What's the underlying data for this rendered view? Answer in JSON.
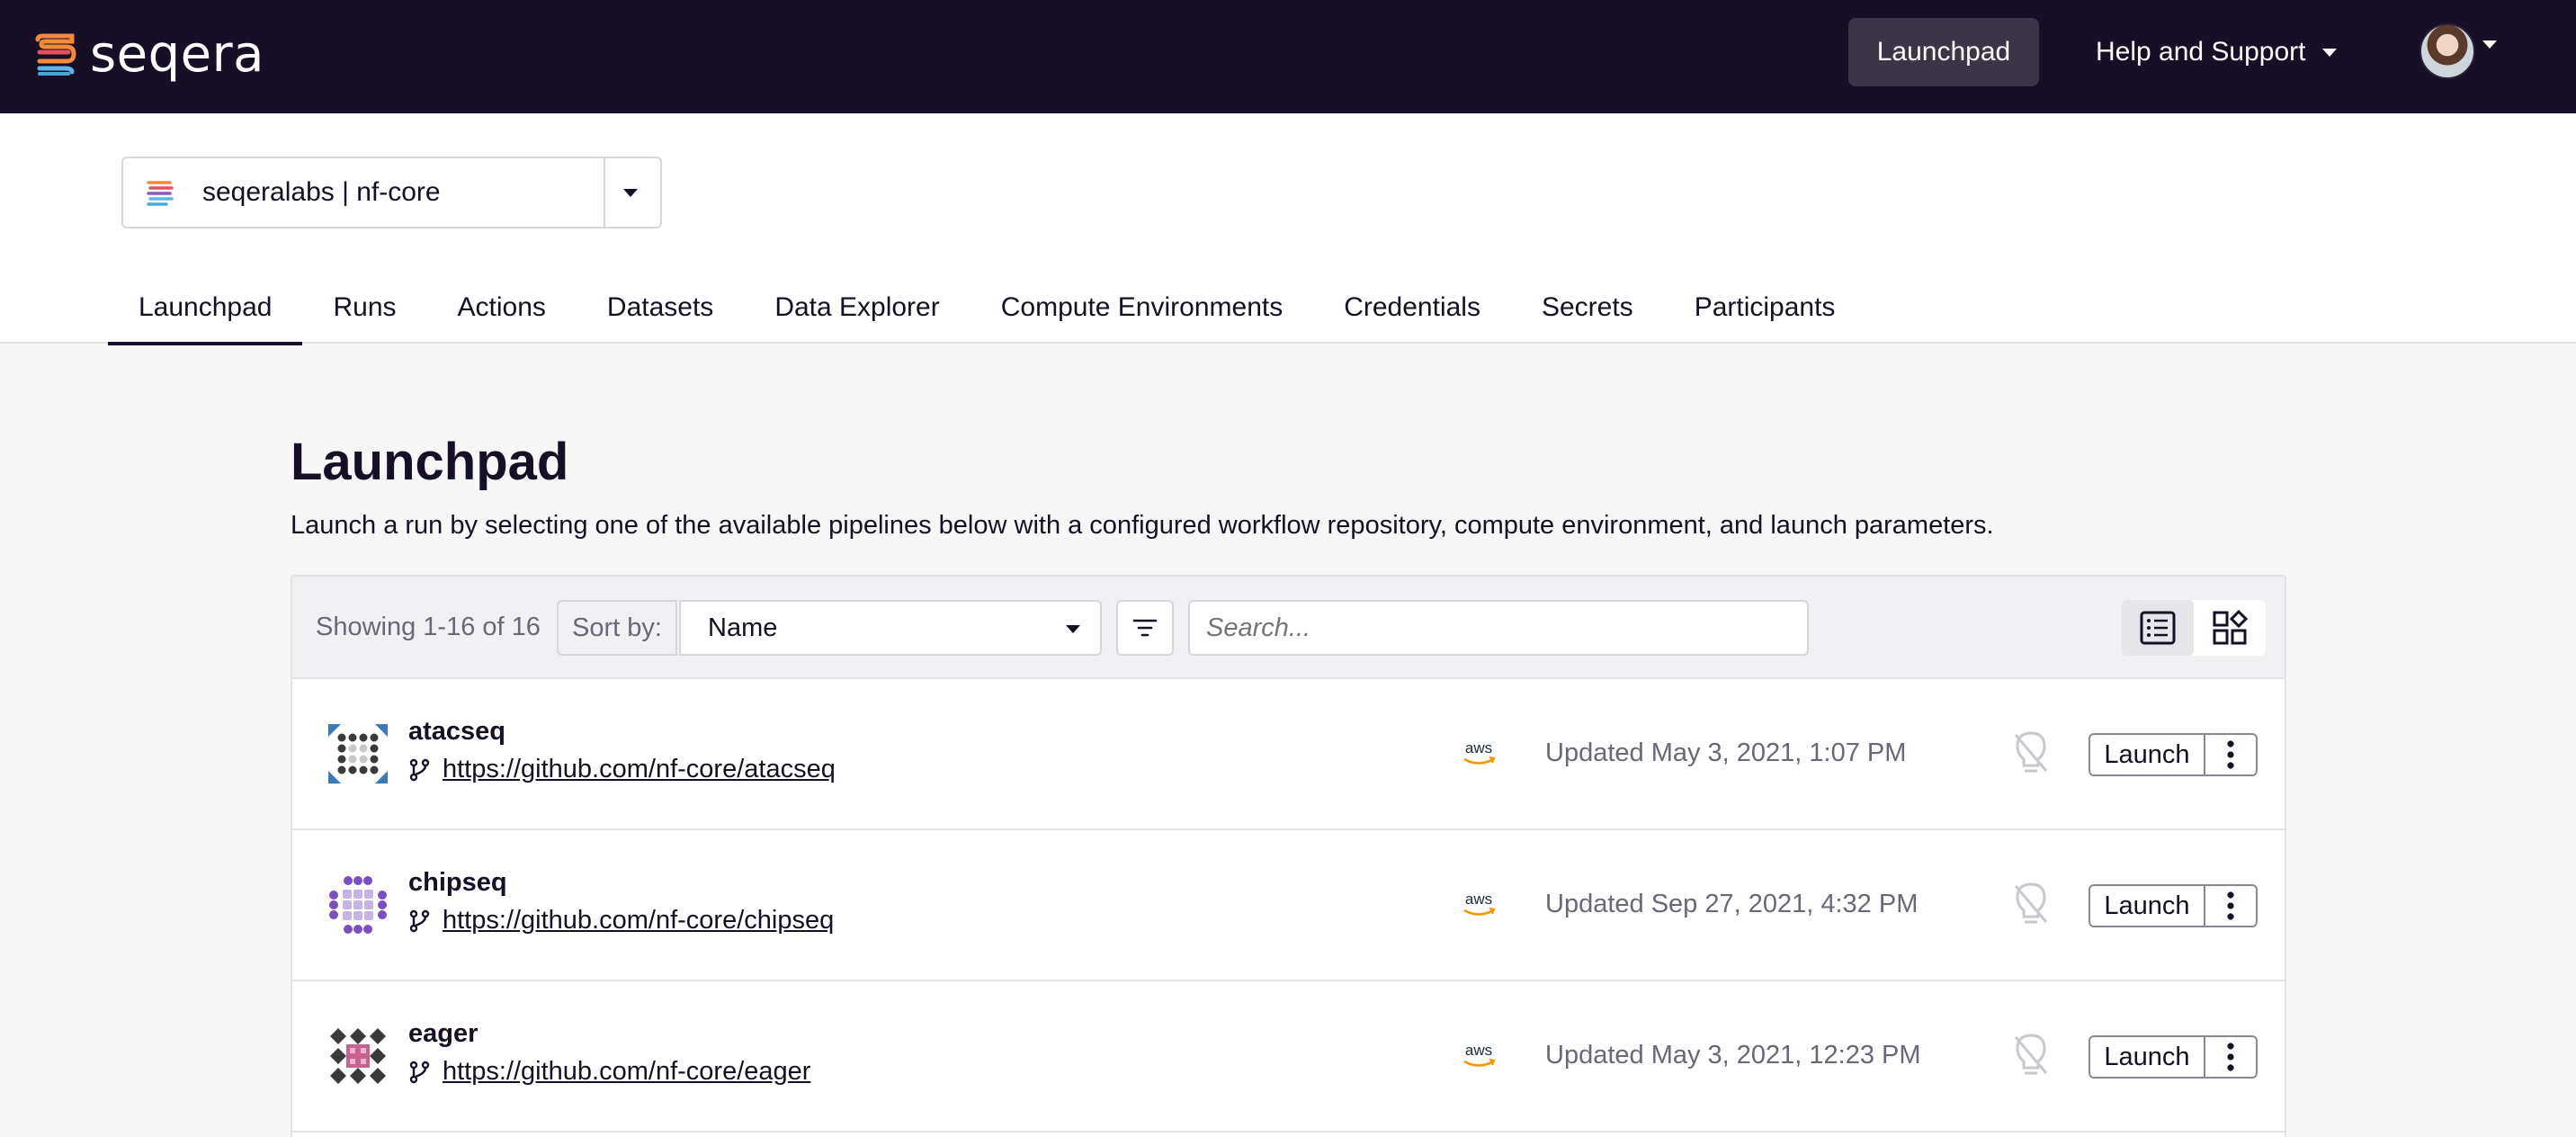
{
  "topnav": {
    "brand": "seqera",
    "launchpad": "Launchpad",
    "help": "Help and Support"
  },
  "workspace": {
    "label": "seqeralabs | nf-core"
  },
  "tabs": [
    {
      "label": "Launchpad",
      "active": true
    },
    {
      "label": "Runs",
      "active": false
    },
    {
      "label": "Actions",
      "active": false
    },
    {
      "label": "Datasets",
      "active": false
    },
    {
      "label": "Data Explorer",
      "active": false
    },
    {
      "label": "Compute Environments",
      "active": false
    },
    {
      "label": "Credentials",
      "active": false
    },
    {
      "label": "Secrets",
      "active": false
    },
    {
      "label": "Participants",
      "active": false
    }
  ],
  "page": {
    "title": "Launchpad",
    "description": "Launch a run by selecting one of the available pipelines below with a configured workflow repository, compute environment, and launch parameters."
  },
  "toolbar": {
    "showing": "Showing 1-16 of 16",
    "sort_by": "Sort by:",
    "sort_value": "Name",
    "search_placeholder": "Search..."
  },
  "pipelines": [
    {
      "name": "atacseq",
      "repo": "https://github.com/nf-core/atacseq",
      "provider": "aws",
      "updated": "Updated May 3, 2021, 1:07 PM",
      "launch": "Launch"
    },
    {
      "name": "chipseq",
      "repo": "https://github.com/nf-core/chipseq",
      "provider": "aws",
      "updated": "Updated Sep 27, 2021, 4:32 PM",
      "launch": "Launch"
    },
    {
      "name": "eager",
      "repo": "https://github.com/nf-core/eager",
      "provider": "aws",
      "updated": "Updated May 3, 2021, 12:23 PM",
      "launch": "Launch"
    }
  ],
  "colors": {
    "nav_bg": "#160f26",
    "page_bg": "#f7f7f8",
    "text": "#160f26",
    "muted": "#6b6678"
  }
}
